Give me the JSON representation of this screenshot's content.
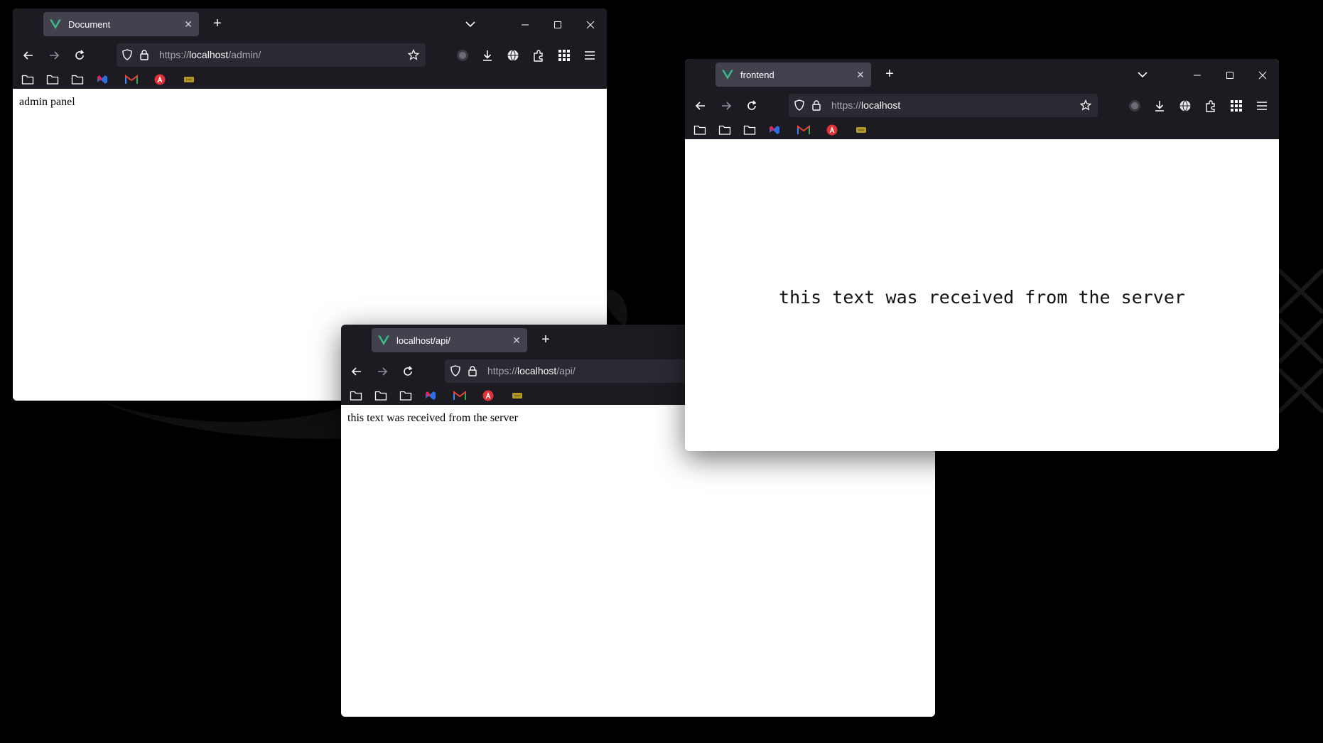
{
  "desktop": {
    "background_color": "#000000"
  },
  "windows": {
    "admin": {
      "tab_title": "Document",
      "url": {
        "protocol": "https://",
        "host": "localhost",
        "path": "/admin/"
      },
      "content_text": "admin panel"
    },
    "api": {
      "tab_title": "localhost/api/",
      "url": {
        "protocol": "https://",
        "host": "localhost",
        "path": "/api/"
      },
      "content_text": "this text was received from the server"
    },
    "frontend": {
      "tab_title": "frontend",
      "url": {
        "protocol": "https://",
        "host": "localhost",
        "path": ""
      },
      "content_text": "this text was received from the server"
    }
  },
  "icons": {
    "tab_logo": "vue-logo-icon",
    "tab_close": "close-icon",
    "new_tab": "plus-icon",
    "tabs_list": "chevron-down-icon",
    "minimize": "minimize-icon",
    "maximize": "maximize-icon",
    "close_window": "close-icon",
    "back": "back-arrow-icon",
    "forward": "forward-arrow-icon",
    "reload": "reload-icon",
    "tracking_protection": "shield-icon",
    "site_security": "lock-icon",
    "bookmark_star": "star-icon",
    "toolbar": [
      "account-icon",
      "download-icon",
      "globe-icon",
      "extensions-icon",
      "grid-icon",
      "hamburger-menu-icon"
    ],
    "bookmarks_bar": [
      "folder-icon",
      "folder-icon",
      "folder-icon",
      "vscode-icon",
      "gmail-icon",
      "angular-icon",
      "ticket-icon"
    ]
  },
  "colors": {
    "chrome_bg": "#1c1b22",
    "tab_bg": "#42414d",
    "urlbar_bg": "#2b2a33",
    "text_light": "#fbfbfe",
    "text_dim": "#a9a9b3",
    "vue_green": "#41b883",
    "vue_dark": "#35495e"
  }
}
